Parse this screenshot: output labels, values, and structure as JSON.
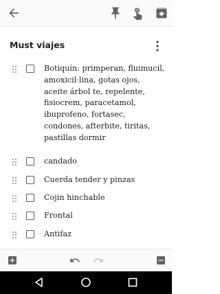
{
  "note": {
    "title": "Must viajes",
    "items": [
      {
        "text": "Botiquín: primperan, fluimucil, amoxicil·lina, gotas ojos, aceite árbol te, repelente, fisiocrem, paracetamol, ibuprofeno, fortasec, condones, afterbite, tiritas, pastillas dormir",
        "checked": false
      },
      {
        "text": "candado",
        "checked": false
      },
      {
        "text": "Cuerda tender y pinzas",
        "checked": false
      },
      {
        "text": "Cojin hinchable",
        "checked": false
      },
      {
        "text": "Frontal",
        "checked": false
      },
      {
        "text": "Antifaz",
        "checked": false
      }
    ]
  },
  "icons": {
    "top": [
      "back-arrow-icon",
      "pin-icon",
      "reminder-icon",
      "archive-icon"
    ],
    "bottom": [
      "add-box-icon",
      "undo-icon",
      "redo-icon",
      "more-options-icon"
    ],
    "nav": [
      "nav-back-icon",
      "nav-home-icon",
      "nav-recents-icon"
    ]
  },
  "colors": {
    "icon": "#5f6368",
    "text": "#202020",
    "bar_background": "#fafafa",
    "nav_background": "#000000"
  }
}
